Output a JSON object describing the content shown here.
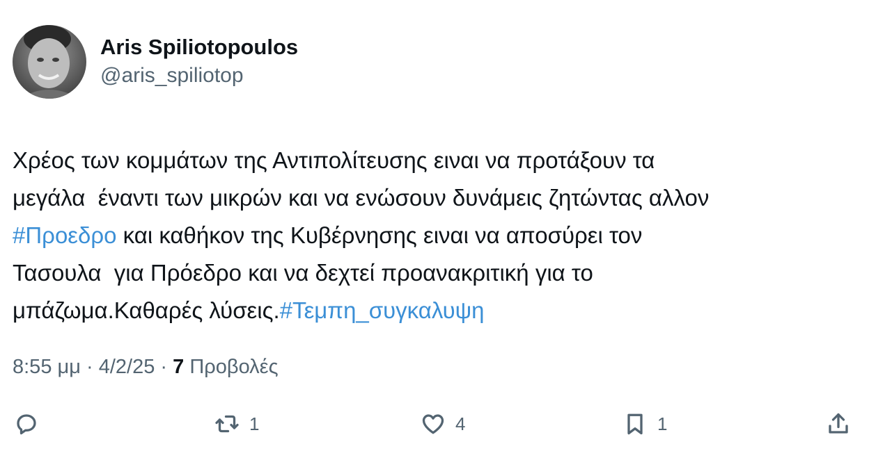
{
  "author": {
    "name": "Aris Spiliotopoulos",
    "handle": "@aris_spiliotop",
    "avatar_icon": "profile-photo"
  },
  "tweet": {
    "lines": [
      [
        {
          "text": "Χρέος των κομμάτων της Αντιπολίτευσης ειναι να προτάξουν τα",
          "type": "text"
        }
      ],
      [
        {
          "text": "μεγάλα  έναντι των μικρών και να ενώσουν δυνάμεις ζητώντας αλλον",
          "type": "text"
        }
      ],
      [
        {
          "text": "#Προεδρο",
          "type": "hashtag"
        },
        {
          "text": " και καθήκον της Κυβέρνησης ειναι να αποσύρει τον",
          "type": "text"
        }
      ],
      [
        {
          "text": "Τασουλα  για Πρόεδρο και να δεχτεί προανακριτική για το",
          "type": "text"
        }
      ],
      [
        {
          "text": "μπάζωμα.Καθαρές λύσεις.",
          "type": "text"
        },
        {
          "text": "#Τεμπη_συγκαλυψη",
          "type": "hashtag"
        }
      ]
    ]
  },
  "meta": {
    "time": "8:55 μμ",
    "separator": " · ",
    "date": "4/2/25",
    "views_count": "7",
    "views_label": " Προβολές"
  },
  "actions": {
    "reply": {
      "icon": "reply-icon",
      "count": ""
    },
    "retweet": {
      "icon": "retweet-icon",
      "count": "1"
    },
    "like": {
      "icon": "heart-icon",
      "count": "4"
    },
    "bookmark": {
      "icon": "bookmark-icon",
      "count": "1"
    },
    "share": {
      "icon": "share-icon",
      "count": ""
    }
  },
  "colors": {
    "text": "#0f1419",
    "secondary": "#536471",
    "hashtag": "#3b8fd6",
    "background": "#ffffff"
  }
}
